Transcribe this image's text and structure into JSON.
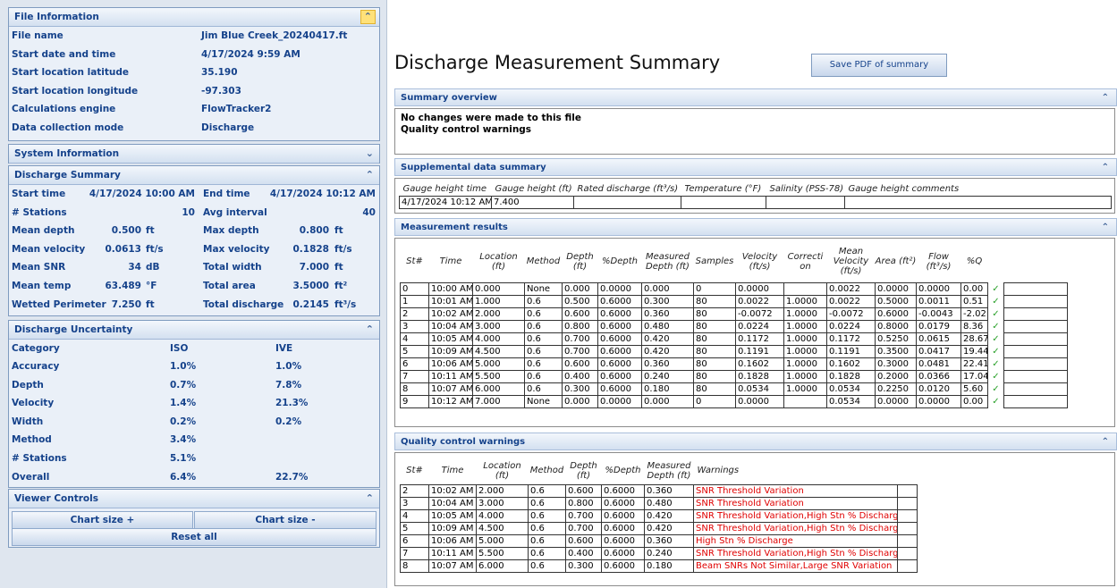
{
  "file_info": {
    "title": "File Information",
    "rows": [
      {
        "label": "File name",
        "value": "Jim Blue Creek_20240417.ft"
      },
      {
        "label": "Start date and time",
        "value": "4/17/2024 9:59 AM"
      },
      {
        "label": "Start location latitude",
        "value": "35.190"
      },
      {
        "label": "Start location longitude",
        "value": "-97.303"
      },
      {
        "label": "Calculations engine",
        "value": "FlowTracker2"
      },
      {
        "label": "Data collection mode",
        "value": "Discharge"
      }
    ]
  },
  "system_info": {
    "title": "System Information"
  },
  "discharge_summary": {
    "title": "Discharge Summary",
    "rows": [
      {
        "l1": "Start time",
        "v1": "4/17/2024 10:00 AM",
        "l2": "End time",
        "v2": "4/17/2024 10:12 AM"
      },
      {
        "l1": "# Stations",
        "v1": "10",
        "l2": "Avg interval",
        "v2": "40"
      },
      {
        "l1": "Mean depth",
        "v1": "0.500",
        "u1": "ft",
        "l2": "Max depth",
        "v2": "0.800",
        "u2": "ft"
      },
      {
        "l1": "Mean velocity",
        "v1": "0.0613",
        "u1": "ft/s",
        "l2": "Max velocity",
        "v2": "0.1828",
        "u2": "ft/s"
      },
      {
        "l1": "Mean SNR",
        "v1": "34",
        "u1": "dB",
        "l2": "Total width",
        "v2": "7.000",
        "u2": "ft"
      },
      {
        "l1": "Mean temp",
        "v1": "63.489",
        "u1": "°F",
        "l2": "Total area",
        "v2": "3.5000",
        "u2": "ft²"
      },
      {
        "l1": "Wetted Perimeter",
        "v1": "7.250",
        "u1": "ft",
        "l2": "Total discharge",
        "v2": "0.2145",
        "u2": "ft³/s"
      }
    ]
  },
  "uncertainty": {
    "title": "Discharge Uncertainty",
    "header": {
      "category": "Category",
      "iso": "ISO",
      "ive": "IVE"
    },
    "rows": [
      {
        "c": "Accuracy",
        "iso": "1.0%",
        "ive": "1.0%"
      },
      {
        "c": "Depth",
        "iso": "0.7%",
        "ive": "7.8%"
      },
      {
        "c": "Velocity",
        "iso": "1.4%",
        "ive": "21.3%"
      },
      {
        "c": "Width",
        "iso": "0.2%",
        "ive": "0.2%"
      },
      {
        "c": "Method",
        "iso": "3.4%",
        "ive": ""
      },
      {
        "c": "# Stations",
        "iso": "5.1%",
        "ive": ""
      },
      {
        "c": "Overall",
        "iso": "6.4%",
        "ive": "22.7%"
      }
    ]
  },
  "viewer": {
    "title": "Viewer Controls",
    "chart_plus": "Chart size +",
    "chart_minus": "Chart size -",
    "reset": "Reset all"
  },
  "main": {
    "title": "Discharge Measurement Summary",
    "save_pdf": "Save PDF of summary",
    "overview_title": "Summary overview",
    "overview_lines": [
      "No changes were made to this file",
      "Quality control warnings"
    ],
    "supplemental_title": "Supplemental data summary",
    "supplemental_headers": [
      "Gauge height time",
      "Gauge height (ft)",
      "Rated discharge (ft³/s)",
      "Temperature (°F)",
      "Salinity (PSS-78)",
      "Gauge height comments"
    ],
    "supplemental_row": [
      "4/17/2024 10:12 AM",
      "7.400",
      "",
      "",
      "",
      ""
    ],
    "results_title": "Measurement results",
    "results_headers": [
      "St#",
      "Time",
      "Location (ft)",
      "Method",
      "Depth (ft)",
      "%Depth",
      "Measured Depth (ft)",
      "Samples",
      "Velocity (ft/s)",
      "Correcti on",
      "Mean Velocity (ft/s)",
      "Area (ft²)",
      "Flow (ft³/s)",
      "%Q"
    ],
    "results_rows": [
      [
        "0",
        "10:00 AM",
        "0.000",
        "None",
        "0.000",
        "0.0000",
        "0.000",
        "0",
        "0.0000",
        "",
        "0.0022",
        "0.0000",
        "0.0000",
        "0.00"
      ],
      [
        "1",
        "10:01 AM",
        "1.000",
        "0.6",
        "0.500",
        "0.6000",
        "0.300",
        "80",
        "0.0022",
        "1.0000",
        "0.0022",
        "0.5000",
        "0.0011",
        "0.51"
      ],
      [
        "2",
        "10:02 AM",
        "2.000",
        "0.6",
        "0.600",
        "0.6000",
        "0.360",
        "80",
        "-0.0072",
        "1.0000",
        "-0.0072",
        "0.6000",
        "-0.0043",
        "-2.02"
      ],
      [
        "3",
        "10:04 AM",
        "3.000",
        "0.6",
        "0.800",
        "0.6000",
        "0.480",
        "80",
        "0.0224",
        "1.0000",
        "0.0224",
        "0.8000",
        "0.0179",
        "8.36"
      ],
      [
        "4",
        "10:05 AM",
        "4.000",
        "0.6",
        "0.700",
        "0.6000",
        "0.420",
        "80",
        "0.1172",
        "1.0000",
        "0.1172",
        "0.5250",
        "0.0615",
        "28.67"
      ],
      [
        "5",
        "10:09 AM",
        "4.500",
        "0.6",
        "0.700",
        "0.6000",
        "0.420",
        "80",
        "0.1191",
        "1.0000",
        "0.1191",
        "0.3500",
        "0.0417",
        "19.44"
      ],
      [
        "6",
        "10:06 AM",
        "5.000",
        "0.6",
        "0.600",
        "0.6000",
        "0.360",
        "80",
        "0.1602",
        "1.0000",
        "0.1602",
        "0.3000",
        "0.0481",
        "22.41"
      ],
      [
        "7",
        "10:11 AM",
        "5.500",
        "0.6",
        "0.400",
        "0.6000",
        "0.240",
        "80",
        "0.1828",
        "1.0000",
        "0.1828",
        "0.2000",
        "0.0366",
        "17.04"
      ],
      [
        "8",
        "10:07 AM",
        "6.000",
        "0.6",
        "0.300",
        "0.6000",
        "0.180",
        "80",
        "0.0534",
        "1.0000",
        "0.0534",
        "0.2250",
        "0.0120",
        "5.60"
      ],
      [
        "9",
        "10:12 AM",
        "7.000",
        "None",
        "0.000",
        "0.0000",
        "0.000",
        "0",
        "0.0000",
        "",
        "0.0534",
        "0.0000",
        "0.0000",
        "0.00"
      ]
    ],
    "check_glyph": "✓",
    "qc_title": "Quality control warnings",
    "qc_headers": [
      "St#",
      "Time",
      "Location (ft)",
      "Method",
      "Depth (ft)",
      "%Depth",
      "Measured Depth (ft)",
      "Warnings"
    ],
    "qc_rows": [
      [
        "2",
        "10:02 AM",
        "2.000",
        "0.6",
        "0.600",
        "0.6000",
        "0.360",
        "SNR Threshold Variation"
      ],
      [
        "3",
        "10:04 AM",
        "3.000",
        "0.6",
        "0.800",
        "0.6000",
        "0.480",
        "SNR Threshold Variation"
      ],
      [
        "4",
        "10:05 AM",
        "4.000",
        "0.6",
        "0.700",
        "0.6000",
        "0.420",
        "SNR Threshold Variation,High Stn % Discharge"
      ],
      [
        "5",
        "10:09 AM",
        "4.500",
        "0.6",
        "0.700",
        "0.6000",
        "0.420",
        "SNR Threshold Variation,High Stn % Discharge"
      ],
      [
        "6",
        "10:06 AM",
        "5.000",
        "0.6",
        "0.600",
        "0.6000",
        "0.360",
        "High Stn % Discharge"
      ],
      [
        "7",
        "10:11 AM",
        "5.500",
        "0.6",
        "0.400",
        "0.6000",
        "0.240",
        "SNR Threshold Variation,High Stn % Discharge"
      ],
      [
        "8",
        "10:07 AM",
        "6.000",
        "0.6",
        "0.300",
        "0.6000",
        "0.180",
        "Beam SNRs Not Similar,Large SNR Variation"
      ]
    ]
  },
  "icons": {
    "collapse": "double-chevron-up-icon",
    "expand": "double-chevron-down-icon",
    "check": "check-icon"
  },
  "colors": {
    "header_text": "#15428b",
    "warning": "#e00000",
    "check": "#2aa02a",
    "highlight": "#ffe17a"
  }
}
